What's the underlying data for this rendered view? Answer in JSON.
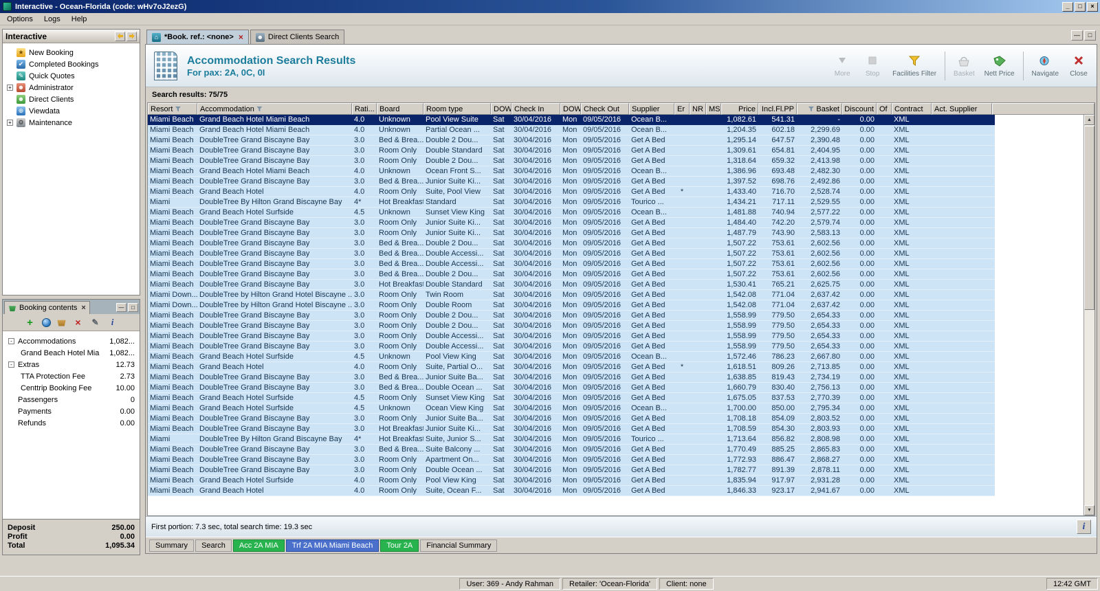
{
  "window": {
    "title": "Interactive - Ocean-Florida (code: wHv7oJ2ezG)",
    "controls": {
      "minimize": "_",
      "maximize": "□",
      "close": "×"
    }
  },
  "menu": {
    "items": [
      "Options",
      "Logs",
      "Help"
    ]
  },
  "sidebar": {
    "title": "Interactive",
    "items": [
      {
        "label": "New Booking",
        "icon": "new-booking-icon",
        "expander": ""
      },
      {
        "label": "Completed Bookings",
        "icon": "completed-bookings-icon",
        "expander": ""
      },
      {
        "label": "Quick Quotes",
        "icon": "quick-quotes-icon",
        "expander": ""
      },
      {
        "label": "Administrator",
        "icon": "administrator-icon",
        "expander": "+"
      },
      {
        "label": "Direct Clients",
        "icon": "direct-clients-icon",
        "expander": ""
      },
      {
        "label": "Viewdata",
        "icon": "viewdata-icon",
        "expander": ""
      },
      {
        "label": "Maintenance",
        "icon": "maintenance-icon",
        "expander": "+"
      }
    ]
  },
  "doc_tabs": [
    {
      "label": "*Book. ref.: <none>",
      "active": true,
      "closable": true
    },
    {
      "label": "Direct Clients Search",
      "active": false,
      "closable": false
    }
  ],
  "doc_controls": {
    "minimize": "—",
    "restore": "□"
  },
  "header": {
    "title": "Accommodation Search Results",
    "subtitle": "For pax: 2A, 0C, 0I",
    "buttons": [
      {
        "label": "More",
        "icon": "more-icon",
        "disabled": true
      },
      {
        "label": "Stop",
        "icon": "stop-icon",
        "disabled": true
      },
      {
        "label": "Facilities Filter",
        "icon": "facilities-filter-icon",
        "disabled": false
      },
      {
        "label": "Basket",
        "icon": "basket-icon",
        "disabled": true,
        "group": true
      },
      {
        "label": "Nett Price",
        "icon": "nett-price-icon",
        "disabled": false
      },
      {
        "label": "Navigate",
        "icon": "navigate-icon",
        "disabled": false,
        "group": true
      },
      {
        "label": "Close",
        "icon": "close-icon",
        "disabled": false
      }
    ]
  },
  "results": {
    "summary": "Search results: 75/75",
    "selected_row": 0,
    "columns": [
      {
        "label": "Resort",
        "filter": true
      },
      {
        "label": "Accommodation",
        "filter": true
      },
      {
        "label": "Rati..."
      },
      {
        "label": "Board"
      },
      {
        "label": "Room type"
      },
      {
        "label": "DOW"
      },
      {
        "label": "Check In"
      },
      {
        "label": "DOW"
      },
      {
        "label": "Check Out"
      },
      {
        "label": "Supplier"
      },
      {
        "label": "Er"
      },
      {
        "label": "NR"
      },
      {
        "label": "MS"
      },
      {
        "label": "Price",
        "numeric": true
      },
      {
        "label": "Incl.Fl.PP",
        "numeric": true
      },
      {
        "label": "Basket",
        "numeric": true,
        "filter": true
      },
      {
        "label": "Discount",
        "numeric": true
      },
      {
        "label": "Of"
      },
      {
        "label": "Contract"
      },
      {
        "label": "Act. Supplier"
      }
    ],
    "rows": [
      [
        "Miami Beach",
        "Grand Beach Hotel Miami Beach",
        "4.0",
        "Unknown",
        "Pool View Suite",
        "Sat",
        "30/04/2016",
        "Mon",
        "09/05/2016",
        "Ocean B...",
        "",
        "",
        "",
        "1,082.61",
        "541.31",
        "-",
        "0.00",
        "",
        "XML",
        ""
      ],
      [
        "Miami Beach",
        "Grand Beach Hotel Miami Beach",
        "4.0",
        "Unknown",
        "Partial Ocean ...",
        "Sat",
        "30/04/2016",
        "Mon",
        "09/05/2016",
        "Ocean B...",
        "",
        "",
        "",
        "1,204.35",
        "602.18",
        "2,299.69",
        "0.00",
        "",
        "XML",
        ""
      ],
      [
        "Miami Beach",
        "DoubleTree Grand Biscayne Bay",
        "3.0",
        "Bed & Brea...",
        "Double 2 Dou...",
        "Sat",
        "30/04/2016",
        "Mon",
        "09/05/2016",
        "Get A Bed",
        "",
        "",
        "",
        "1,295.14",
        "647.57",
        "2,390.48",
        "0.00",
        "",
        "XML",
        ""
      ],
      [
        "Miami Beach",
        "DoubleTree Grand Biscayne Bay",
        "3.0",
        "Room Only",
        "Double Standard",
        "Sat",
        "30/04/2016",
        "Mon",
        "09/05/2016",
        "Get A Bed",
        "",
        "",
        "",
        "1,309.61",
        "654.81",
        "2,404.95",
        "0.00",
        "",
        "XML",
        ""
      ],
      [
        "Miami Beach",
        "DoubleTree Grand Biscayne Bay",
        "3.0",
        "Room Only",
        "Double 2 Dou...",
        "Sat",
        "30/04/2016",
        "Mon",
        "09/05/2016",
        "Get A Bed",
        "",
        "",
        "",
        "1,318.64",
        "659.32",
        "2,413.98",
        "0.00",
        "",
        "XML",
        ""
      ],
      [
        "Miami Beach",
        "Grand Beach Hotel Miami Beach",
        "4.0",
        "Unknown",
        "Ocean Front S...",
        "Sat",
        "30/04/2016",
        "Mon",
        "09/05/2016",
        "Ocean B...",
        "",
        "",
        "",
        "1,386.96",
        "693.48",
        "2,482.30",
        "0.00",
        "",
        "XML",
        ""
      ],
      [
        "Miami Beach",
        "DoubleTree Grand Biscayne Bay",
        "3.0",
        "Bed & Brea...",
        "Junior Suite Ki...",
        "Sat",
        "30/04/2016",
        "Mon",
        "09/05/2016",
        "Get A Bed",
        "",
        "",
        "",
        "1,397.52",
        "698.76",
        "2,492.86",
        "0.00",
        "",
        "XML",
        ""
      ],
      [
        "Miami Beach",
        "Grand Beach Hotel",
        "4.0",
        "Room Only",
        "Suite, Pool View",
        "Sat",
        "30/04/2016",
        "Mon",
        "09/05/2016",
        "Get A Bed",
        "*",
        "",
        "",
        "1,433.40",
        "716.70",
        "2,528.74",
        "0.00",
        "",
        "XML",
        ""
      ],
      [
        "Miami",
        "DoubleTree By Hilton Grand Biscayne Bay",
        "4*",
        "Hot Breakfast",
        "Standard",
        "Sat",
        "30/04/2016",
        "Mon",
        "09/05/2016",
        "Tourico ...",
        "",
        "",
        "",
        "1,434.21",
        "717.11",
        "2,529.55",
        "0.00",
        "",
        "XML",
        ""
      ],
      [
        "Miami Beach",
        "Grand Beach Hotel Surfside",
        "4.5",
        "Unknown",
        "Sunset View King",
        "Sat",
        "30/04/2016",
        "Mon",
        "09/05/2016",
        "Ocean B...",
        "",
        "",
        "",
        "1,481.88",
        "740.94",
        "2,577.22",
        "0.00",
        "",
        "XML",
        ""
      ],
      [
        "Miami Beach",
        "DoubleTree Grand Biscayne Bay",
        "3.0",
        "Room Only",
        "Junior Suite Ki...",
        "Sat",
        "30/04/2016",
        "Mon",
        "09/05/2016",
        "Get A Bed",
        "",
        "",
        "",
        "1,484.40",
        "742.20",
        "2,579.74",
        "0.00",
        "",
        "XML",
        ""
      ],
      [
        "Miami Beach",
        "DoubleTree Grand Biscayne Bay",
        "3.0",
        "Room Only",
        "Junior Suite Ki...",
        "Sat",
        "30/04/2016",
        "Mon",
        "09/05/2016",
        "Get A Bed",
        "",
        "",
        "",
        "1,487.79",
        "743.90",
        "2,583.13",
        "0.00",
        "",
        "XML",
        ""
      ],
      [
        "Miami Beach",
        "DoubleTree Grand Biscayne Bay",
        "3.0",
        "Bed & Brea...",
        "Double 2 Dou...",
        "Sat",
        "30/04/2016",
        "Mon",
        "09/05/2016",
        "Get A Bed",
        "",
        "",
        "",
        "1,507.22",
        "753.61",
        "2,602.56",
        "0.00",
        "",
        "XML",
        ""
      ],
      [
        "Miami Beach",
        "DoubleTree Grand Biscayne Bay",
        "3.0",
        "Bed & Brea...",
        "Double Accessi...",
        "Sat",
        "30/04/2016",
        "Mon",
        "09/05/2016",
        "Get A Bed",
        "",
        "",
        "",
        "1,507.22",
        "753.61",
        "2,602.56",
        "0.00",
        "",
        "XML",
        ""
      ],
      [
        "Miami Beach",
        "DoubleTree Grand Biscayne Bay",
        "3.0",
        "Bed & Brea...",
        "Double Accessi...",
        "Sat",
        "30/04/2016",
        "Mon",
        "09/05/2016",
        "Get A Bed",
        "",
        "",
        "",
        "1,507.22",
        "753.61",
        "2,602.56",
        "0.00",
        "",
        "XML",
        ""
      ],
      [
        "Miami Beach",
        "DoubleTree Grand Biscayne Bay",
        "3.0",
        "Bed & Brea...",
        "Double 2 Dou...",
        "Sat",
        "30/04/2016",
        "Mon",
        "09/05/2016",
        "Get A Bed",
        "",
        "",
        "",
        "1,507.22",
        "753.61",
        "2,602.56",
        "0.00",
        "",
        "XML",
        ""
      ],
      [
        "Miami Beach",
        "DoubleTree Grand Biscayne Bay",
        "3.0",
        "Hot Breakfast",
        "Double Standard",
        "Sat",
        "30/04/2016",
        "Mon",
        "09/05/2016",
        "Get A Bed",
        "",
        "",
        "",
        "1,530.41",
        "765.21",
        "2,625.75",
        "0.00",
        "",
        "XML",
        ""
      ],
      [
        "Miami Down...",
        "DoubleTree by Hilton Grand Hotel Biscayne ...",
        "3.0",
        "Room Only",
        "Twin Room",
        "Sat",
        "30/04/2016",
        "Mon",
        "09/05/2016",
        "Get A Bed",
        "",
        "",
        "",
        "1,542.08",
        "771.04",
        "2,637.42",
        "0.00",
        "",
        "XML",
        ""
      ],
      [
        "Miami Down...",
        "DoubleTree by Hilton Grand Hotel Biscayne ...",
        "3.0",
        "Room Only",
        "Double Room",
        "Sat",
        "30/04/2016",
        "Mon",
        "09/05/2016",
        "Get A Bed",
        "",
        "",
        "",
        "1,542.08",
        "771.04",
        "2,637.42",
        "0.00",
        "",
        "XML",
        ""
      ],
      [
        "Miami Beach",
        "DoubleTree Grand Biscayne Bay",
        "3.0",
        "Room Only",
        "Double 2 Dou...",
        "Sat",
        "30/04/2016",
        "Mon",
        "09/05/2016",
        "Get A Bed",
        "",
        "",
        "",
        "1,558.99",
        "779.50",
        "2,654.33",
        "0.00",
        "",
        "XML",
        ""
      ],
      [
        "Miami Beach",
        "DoubleTree Grand Biscayne Bay",
        "3.0",
        "Room Only",
        "Double 2 Dou...",
        "Sat",
        "30/04/2016",
        "Mon",
        "09/05/2016",
        "Get A Bed",
        "",
        "",
        "",
        "1,558.99",
        "779.50",
        "2,654.33",
        "0.00",
        "",
        "XML",
        ""
      ],
      [
        "Miami Beach",
        "DoubleTree Grand Biscayne Bay",
        "3.0",
        "Room Only",
        "Double Accessi...",
        "Sat",
        "30/04/2016",
        "Mon",
        "09/05/2016",
        "Get A Bed",
        "",
        "",
        "",
        "1,558.99",
        "779.50",
        "2,654.33",
        "0.00",
        "",
        "XML",
        ""
      ],
      [
        "Miami Beach",
        "DoubleTree Grand Biscayne Bay",
        "3.0",
        "Room Only",
        "Double Accessi...",
        "Sat",
        "30/04/2016",
        "Mon",
        "09/05/2016",
        "Get A Bed",
        "",
        "",
        "",
        "1,558.99",
        "779.50",
        "2,654.33",
        "0.00",
        "",
        "XML",
        ""
      ],
      [
        "Miami Beach",
        "Grand Beach Hotel Surfside",
        "4.5",
        "Unknown",
        "Pool View King",
        "Sat",
        "30/04/2016",
        "Mon",
        "09/05/2016",
        "Ocean B...",
        "",
        "",
        "",
        "1,572.46",
        "786.23",
        "2,667.80",
        "0.00",
        "",
        "XML",
        ""
      ],
      [
        "Miami Beach",
        "Grand Beach Hotel",
        "4.0",
        "Room Only",
        "Suite, Partial O...",
        "Sat",
        "30/04/2016",
        "Mon",
        "09/05/2016",
        "Get A Bed",
        "*",
        "",
        "",
        "1,618.51",
        "809.26",
        "2,713.85",
        "0.00",
        "",
        "XML",
        ""
      ],
      [
        "Miami Beach",
        "DoubleTree Grand Biscayne Bay",
        "3.0",
        "Bed & Brea...",
        "Junior Suite Ba...",
        "Sat",
        "30/04/2016",
        "Mon",
        "09/05/2016",
        "Get A Bed",
        "",
        "",
        "",
        "1,638.85",
        "819.43",
        "2,734.19",
        "0.00",
        "",
        "XML",
        ""
      ],
      [
        "Miami Beach",
        "DoubleTree Grand Biscayne Bay",
        "3.0",
        "Bed & Brea...",
        "Double Ocean ...",
        "Sat",
        "30/04/2016",
        "Mon",
        "09/05/2016",
        "Get A Bed",
        "",
        "",
        "",
        "1,660.79",
        "830.40",
        "2,756.13",
        "0.00",
        "",
        "XML",
        ""
      ],
      [
        "Miami Beach",
        "Grand Beach Hotel Surfside",
        "4.5",
        "Room Only",
        "Sunset View King",
        "Sat",
        "30/04/2016",
        "Mon",
        "09/05/2016",
        "Get A Bed",
        "",
        "",
        "",
        "1,675.05",
        "837.53",
        "2,770.39",
        "0.00",
        "",
        "XML",
        ""
      ],
      [
        "Miami Beach",
        "Grand Beach Hotel Surfside",
        "4.5",
        "Unknown",
        "Ocean View King",
        "Sat",
        "30/04/2016",
        "Mon",
        "09/05/2016",
        "Ocean B...",
        "",
        "",
        "",
        "1,700.00",
        "850.00",
        "2,795.34",
        "0.00",
        "",
        "XML",
        ""
      ],
      [
        "Miami Beach",
        "DoubleTree Grand Biscayne Bay",
        "3.0",
        "Room Only",
        "Junior Suite Ba...",
        "Sat",
        "30/04/2016",
        "Mon",
        "09/05/2016",
        "Get A Bed",
        "",
        "",
        "",
        "1,708.18",
        "854.09",
        "2,803.52",
        "0.00",
        "",
        "XML",
        ""
      ],
      [
        "Miami Beach",
        "DoubleTree Grand Biscayne Bay",
        "3.0",
        "Hot Breakfast",
        "Junior Suite Ki...",
        "Sat",
        "30/04/2016",
        "Mon",
        "09/05/2016",
        "Get A Bed",
        "",
        "",
        "",
        "1,708.59",
        "854.30",
        "2,803.93",
        "0.00",
        "",
        "XML",
        ""
      ],
      [
        "Miami",
        "DoubleTree By Hilton Grand Biscayne Bay",
        "4*",
        "Hot Breakfast",
        "Suite, Junior S...",
        "Sat",
        "30/04/2016",
        "Mon",
        "09/05/2016",
        "Tourico ...",
        "",
        "",
        "",
        "1,713.64",
        "856.82",
        "2,808.98",
        "0.00",
        "",
        "XML",
        ""
      ],
      [
        "Miami Beach",
        "DoubleTree Grand Biscayne Bay",
        "3.0",
        "Bed & Brea...",
        "Suite Balcony ...",
        "Sat",
        "30/04/2016",
        "Mon",
        "09/05/2016",
        "Get A Bed",
        "",
        "",
        "",
        "1,770.49",
        "885.25",
        "2,865.83",
        "0.00",
        "",
        "XML",
        ""
      ],
      [
        "Miami Beach",
        "DoubleTree Grand Biscayne Bay",
        "3.0",
        "Room Only",
        "Apartment On...",
        "Sat",
        "30/04/2016",
        "Mon",
        "09/05/2016",
        "Get A Bed",
        "",
        "",
        "",
        "1,772.93",
        "886.47",
        "2,868.27",
        "0.00",
        "",
        "XML",
        ""
      ],
      [
        "Miami Beach",
        "DoubleTree Grand Biscayne Bay",
        "3.0",
        "Room Only",
        "Double Ocean ...",
        "Sat",
        "30/04/2016",
        "Mon",
        "09/05/2016",
        "Get A Bed",
        "",
        "",
        "",
        "1,782.77",
        "891.39",
        "2,878.11",
        "0.00",
        "",
        "XML",
        ""
      ],
      [
        "Miami Beach",
        "Grand Beach Hotel Surfside",
        "4.0",
        "Room Only",
        "Pool View King",
        "Sat",
        "30/04/2016",
        "Mon",
        "09/05/2016",
        "Get A Bed",
        "",
        "",
        "",
        "1,835.94",
        "917.97",
        "2,931.28",
        "0.00",
        "",
        "XML",
        ""
      ],
      [
        "Miami Beach",
        "Grand Beach Hotel",
        "4.0",
        "Room Only",
        "Suite, Ocean F...",
        "Sat",
        "30/04/2016",
        "Mon",
        "09/05/2016",
        "Get A Bed",
        "",
        "",
        "",
        "1,846.33",
        "923.17",
        "2,941.67",
        "0.00",
        "",
        "XML",
        ""
      ]
    ]
  },
  "booking_contents": {
    "title": "Booking contents",
    "close": "×",
    "toolbar": [
      "add-icon",
      "globe-icon",
      "basket-icon",
      "delete-icon",
      "edit-icon",
      "info-icon"
    ],
    "tree": [
      {
        "label": "Accommodations",
        "value": "1,082...",
        "level": 0,
        "expander": "-"
      },
      {
        "label": "Grand Beach Hotel Mia",
        "value": "1,082...",
        "level": 1,
        "expander": ""
      },
      {
        "label": "Extras",
        "value": "12.73",
        "level": 0,
        "expander": "-"
      },
      {
        "label": "TTA Protection Fee",
        "value": "2.73",
        "level": 1,
        "expander": ""
      },
      {
        "label": "Centtrip Booking Fee",
        "value": "10.00",
        "level": 1,
        "expander": ""
      },
      {
        "label": "Passengers",
        "value": "0",
        "level": 0,
        "expander": ""
      },
      {
        "label": "Payments",
        "value": "0.00",
        "level": 0,
        "expander": ""
      },
      {
        "label": "Refunds",
        "value": "0.00",
        "level": 0,
        "expander": ""
      }
    ],
    "summary": [
      {
        "label": "Deposit",
        "value": "250.00"
      },
      {
        "label": "Profit",
        "value": "0.00"
      },
      {
        "label": "Total",
        "value": "1,095.34"
      }
    ]
  },
  "status_strip": {
    "text": "First portion: 7.3 sec, total search time: 19.3 sec",
    "info": "i"
  },
  "bottom_tabs": [
    {
      "label": "Summary",
      "style": "plain"
    },
    {
      "label": "Search",
      "style": "plain"
    },
    {
      "label": "Acc 2A MIA",
      "style": "green"
    },
    {
      "label": "Trf 2A MIA Miami Beach",
      "style": "blue"
    },
    {
      "label": "Tour 2A",
      "style": "green"
    },
    {
      "label": "Financial Summary",
      "style": "plain"
    }
  ],
  "statusbar": {
    "user": "User: 369 - Andy Rahman",
    "retailer": "Retailer: 'Ocean-Florida'",
    "client": "Client: none",
    "time": "12:42 GMT"
  }
}
